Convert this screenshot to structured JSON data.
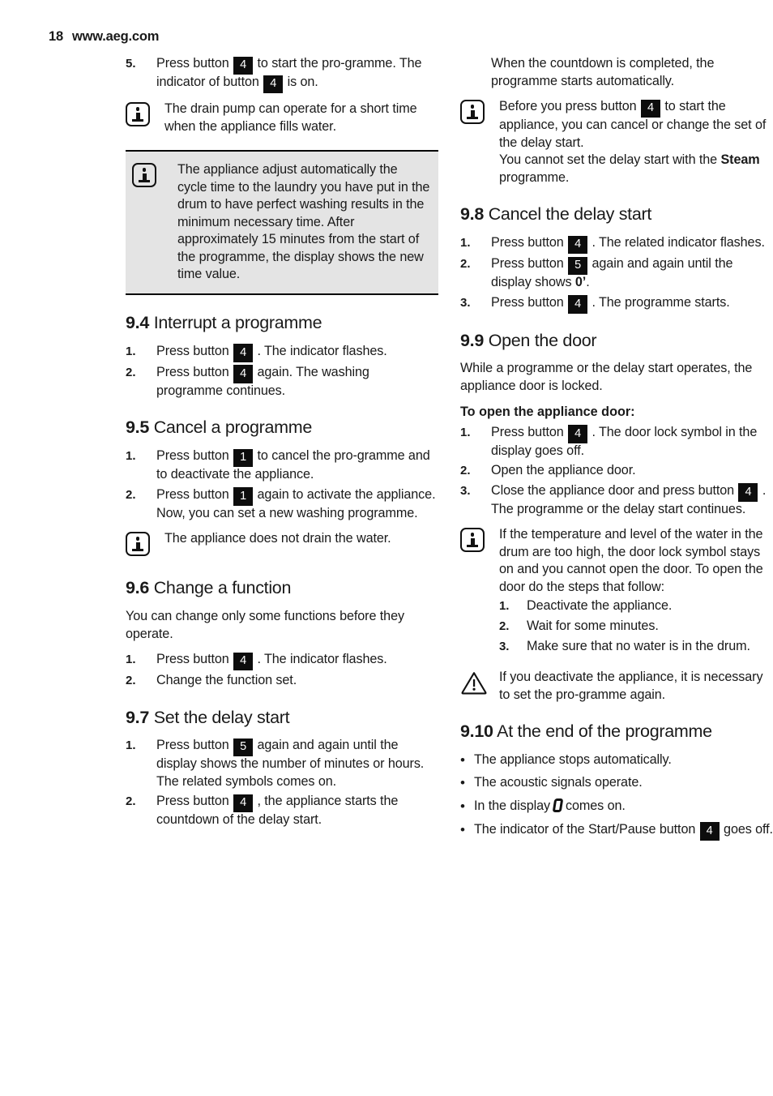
{
  "header": {
    "page_number": "18",
    "site": "www.aeg.com"
  },
  "icons": {
    "info": "info-icon",
    "warning": "warning-icon",
    "display_zero": "display-zero-symbol"
  },
  "left_column": {
    "step5": {
      "marker": "5.",
      "text_a": "Press button ",
      "badge_a": "4",
      "text_b": " to start the pro-gramme. The indicator of button ",
      "badge_b": "4",
      "text_c": " is on."
    },
    "note_drain": {
      "text": "The drain pump can operate for a short time when the appliance fills water."
    },
    "note_shaded": {
      "text": "The appliance adjust automatically the cycle time to the laundry you have put in the drum to have perfect washing results in the minimum necessary time. After approximately 15 minutes from the start of the programme, the display shows the new time value."
    },
    "s94": {
      "num": "9.4",
      "title": "Interrupt a programme",
      "steps": [
        {
          "marker": "1.",
          "pre": "Press button ",
          "badge": "4",
          "post": " . The indicator flashes."
        },
        {
          "marker": "2.",
          "pre": "Press button ",
          "badge": "4",
          "post": " again. The washing programme continues."
        }
      ]
    },
    "s95": {
      "num": "9.5",
      "title": "Cancel a programme",
      "steps": [
        {
          "marker": "1.",
          "pre": "Press button ",
          "badge": "1",
          "post": " to cancel the pro-gramme and to deactivate the appliance."
        },
        {
          "marker": "2.",
          "pre": "Press button ",
          "badge": "1",
          "post": " again to activate the appliance. Now, you can set a new washing programme."
        }
      ],
      "note": {
        "text": "The appliance does not drain the water."
      }
    },
    "s96": {
      "num": "9.6",
      "title": "Change a function",
      "intro": "You can change only some functions before they operate.",
      "steps": [
        {
          "marker": "1.",
          "pre": "Press button ",
          "badge": "4",
          "post": " . The indicator flashes."
        },
        {
          "marker": "2.",
          "pre": "Change the function set.",
          "badge": "",
          "post": ""
        }
      ]
    },
    "s97": {
      "num": "9.7",
      "title": "Set the delay start",
      "steps": [
        {
          "marker": "1.",
          "pre": "Press button ",
          "badge": "5",
          "post": " again and again until the display shows the number of minutes or hours. The related symbols comes on."
        },
        {
          "marker": "2.",
          "pre": "Press button ",
          "badge": "4",
          "post": " , the appliance starts the countdown of the delay start."
        }
      ]
    }
  },
  "right_column": {
    "countdown_para": "When the countdown is completed, the programme starts automatically.",
    "note_before_press": {
      "text_a": "Before you press button ",
      "badge": "4",
      "text_b": " to start the appliance, you can cancel or change the set of the delay start.",
      "line2_a": "You cannot set the delay start with the ",
      "line2_bold": "Steam",
      "line2_b": " programme."
    },
    "s98": {
      "num": "9.8",
      "title": "Cancel the delay start",
      "steps": [
        {
          "marker": "1.",
          "pre": "Press button ",
          "badge": "4",
          "post": " . The related indicator flashes."
        },
        {
          "marker": "2.",
          "pre": "Press button ",
          "badge": "5",
          "post_a": " again and again until the display shows ",
          "bold": "0’",
          "post_b": "."
        },
        {
          "marker": "3.",
          "pre": "Press button ",
          "badge": "4",
          "post": " . The programme starts."
        }
      ]
    },
    "s99": {
      "num": "9.9",
      "title": "Open the door",
      "intro": "While a programme or the delay start operates, the appliance door is locked.",
      "subhead": "To open the appliance door:",
      "steps": [
        {
          "marker": "1.",
          "pre": "Press button ",
          "badge": "4",
          "post": " . The door lock symbol in the display goes off."
        },
        {
          "marker": "2.",
          "pre": "Open the appliance door.",
          "badge": "",
          "post": ""
        },
        {
          "marker": "3.",
          "pre": "Close the appliance door and press button ",
          "badge": "4",
          "post": " . The programme or the delay start continues."
        }
      ],
      "note": {
        "text": "If the temperature and level of the water in the drum are too high, the door lock symbol stays on and you cannot open the door. To open the door do the steps that follow:",
        "steps": [
          {
            "marker": "1.",
            "text": "Deactivate the appliance."
          },
          {
            "marker": "2.",
            "text": "Wait for some minutes."
          },
          {
            "marker": "3.",
            "text": "Make sure that no water is in the drum."
          }
        ]
      },
      "warning": {
        "text": "If you deactivate the appliance, it is necessary to set the pro-gramme again."
      }
    },
    "s910": {
      "num": "9.10",
      "title": "At the end of the programme",
      "bullets": [
        {
          "pre": "The appliance stops automatically.",
          "badge": "",
          "post": ""
        },
        {
          "pre": "The acoustic signals operate.",
          "badge": "",
          "post": ""
        },
        {
          "pre": "In the display",
          "symbol": true,
          "post": "comes on."
        },
        {
          "pre": "The indicator of the Start/Pause button ",
          "badge": "4",
          "post": " goes off."
        }
      ]
    }
  }
}
